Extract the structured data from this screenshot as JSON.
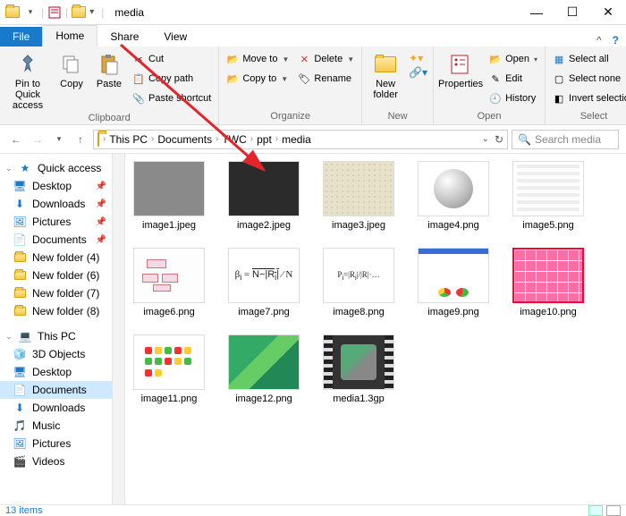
{
  "titlebar": {
    "title": "media"
  },
  "window_controls": {
    "min": "—",
    "max": "☐",
    "close": "✕"
  },
  "tabs": {
    "file": "File",
    "home": "Home",
    "share": "Share",
    "view": "View"
  },
  "ribbon": {
    "clipboard": {
      "label": "Clipboard",
      "pin": "Pin to Quick access",
      "copy": "Copy",
      "paste": "Paste",
      "cut": "Cut",
      "copypath": "Copy path",
      "shortcut": "Paste shortcut"
    },
    "organize": {
      "label": "Organize",
      "moveto": "Move to",
      "copyto": "Copy to",
      "delete": "Delete",
      "rename": "Rename"
    },
    "new": {
      "label": "New",
      "newfolder": "New folder"
    },
    "open": {
      "label": "Open",
      "properties": "Properties",
      "open": "Open",
      "edit": "Edit",
      "history": "History"
    },
    "select": {
      "label": "Select",
      "all": "Select all",
      "none": "Select none",
      "invert": "Invert selection"
    }
  },
  "breadcrumb": [
    "This PC",
    "Documents",
    "TWC",
    "ppt",
    "media"
  ],
  "search": {
    "placeholder": "Search media"
  },
  "sidebar": {
    "quick": "Quick access",
    "items_pinned": [
      "Desktop",
      "Downloads",
      "Pictures",
      "Documents"
    ],
    "items_folders": [
      "New folder (4)",
      "New folder (6)",
      "New folder (7)",
      "New folder (8)"
    ],
    "thispc": "This PC",
    "pc_items": [
      "3D Objects",
      "Desktop",
      "Documents",
      "Downloads",
      "Music",
      "Pictures",
      "Videos"
    ]
  },
  "files": [
    {
      "name": "image1.jpeg",
      "cls": "th-gray"
    },
    {
      "name": "image2.jpeg",
      "cls": "th-dark"
    },
    {
      "name": "image3.jpeg",
      "cls": "th-paper"
    },
    {
      "name": "image4.png",
      "cls": "th-white knob-host"
    },
    {
      "name": "image5.png",
      "cls": "th-sheet"
    },
    {
      "name": "image6.png",
      "cls": "th-pale diag-host"
    },
    {
      "name": "image7.png",
      "cls": "th-white formula1"
    },
    {
      "name": "image8.png",
      "cls": "th-white formula2"
    },
    {
      "name": "image9.png",
      "cls": "th-doc"
    },
    {
      "name": "image10.png",
      "cls": "th-pink"
    },
    {
      "name": "image11.png",
      "cls": "th-white dash-host"
    },
    {
      "name": "image12.png",
      "cls": "th-green"
    },
    {
      "name": "media1.3gp",
      "cls": "th-film"
    }
  ],
  "status": {
    "count": "13 items"
  }
}
